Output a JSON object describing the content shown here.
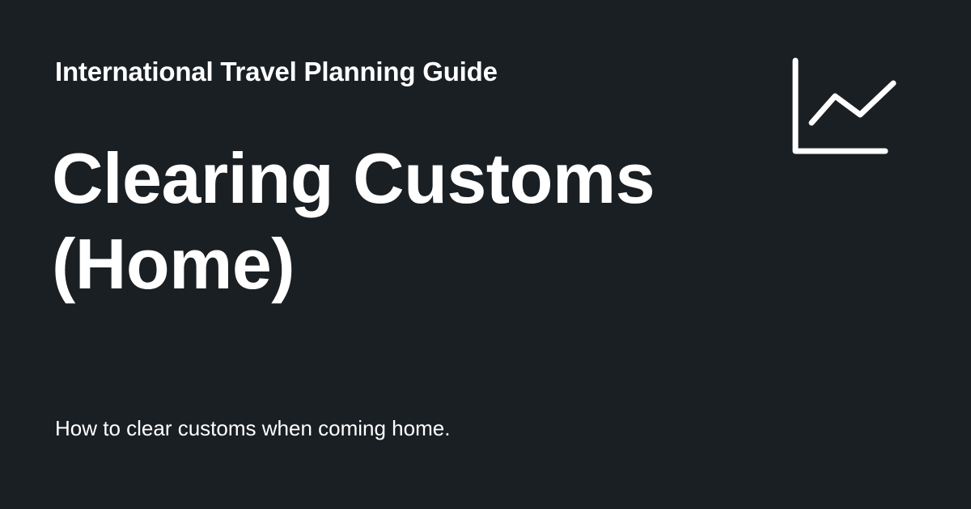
{
  "card": {
    "site_name": "International Travel Planning Guide",
    "title": "Clearing Customs (Home)",
    "description": "How to clear customs when coming home.",
    "logo_icon": "line-chart-icon"
  },
  "colors": {
    "background": "#1a1f23",
    "text": "#ffffff"
  }
}
